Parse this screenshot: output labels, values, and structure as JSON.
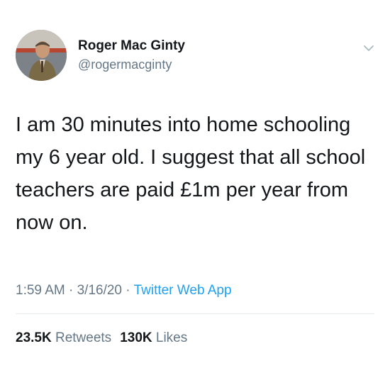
{
  "author": {
    "display_name": "Roger Mac Ginty",
    "handle": "@rogermacginty",
    "avatar_icon": "profile-photo"
  },
  "tweet": {
    "text": "I am 30 minutes into home schooling my 6 year old. I suggest that all school teachers are paid £1m per year from now on.",
    "time": "1:59 AM",
    "separator": " · ",
    "date": "3/16/20",
    "source": "Twitter Web App"
  },
  "stats": {
    "retweets_count": "23.5K",
    "retweets_label": "Retweets",
    "likes_count": "130K",
    "likes_label": "Likes"
  },
  "menu": {
    "icon": "chevron-down-icon"
  },
  "colors": {
    "text": "#14171a",
    "secondary": "#657786",
    "accent": "#1da1f2",
    "divider": "#e6ecf0"
  }
}
